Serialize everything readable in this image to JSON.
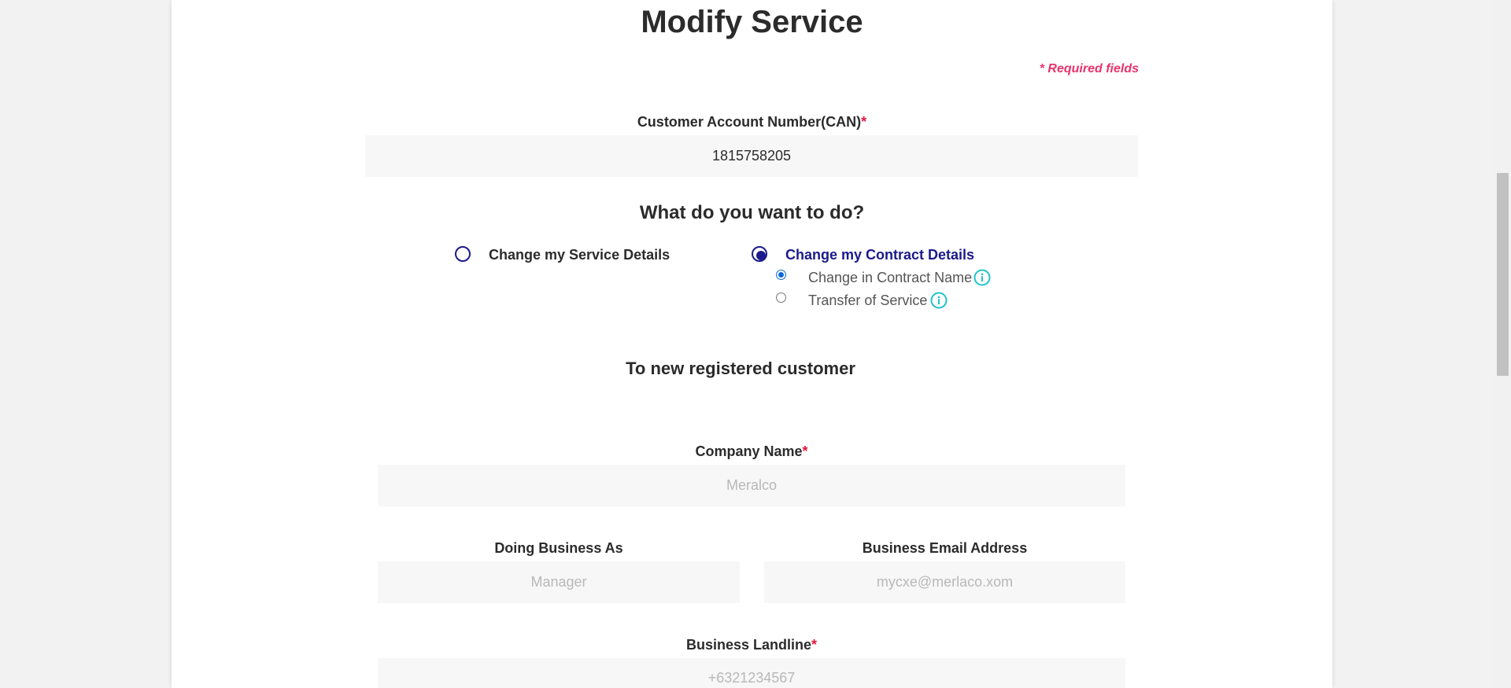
{
  "page": {
    "title": "Modify Service",
    "required_note": "* Required fields"
  },
  "can": {
    "label": "Customer Account Number(CAN)",
    "required_mark": "*",
    "value": "1815758205"
  },
  "question": "What do you want to do?",
  "options": [
    {
      "label": "Change my Service Details",
      "checked": false
    },
    {
      "label": "Change my Contract Details",
      "checked": true
    }
  ],
  "sub_options": [
    {
      "label": "Change in Contract Name",
      "checked": true,
      "icon": "info-icon"
    },
    {
      "label": "Transfer of Service",
      "checked": false,
      "icon": "info-icon"
    }
  ],
  "section_title": "To new registered customer",
  "fields": {
    "company_name": {
      "label": "Company Name",
      "required_mark": "*",
      "placeholder": "Meralco"
    },
    "doing_business_as": {
      "label": "Doing Business As",
      "placeholder": "Manager"
    },
    "business_email": {
      "label": "Business Email Address",
      "placeholder": "mycxe@merlaco.xom"
    },
    "business_landline": {
      "label": "Business Landline",
      "required_mark": "*",
      "placeholder": "+6321234567"
    }
  },
  "colors": {
    "accent": "#1a1a8c",
    "required": "#e3183f",
    "note": "#e8336b",
    "info": "#1fc3c9"
  }
}
